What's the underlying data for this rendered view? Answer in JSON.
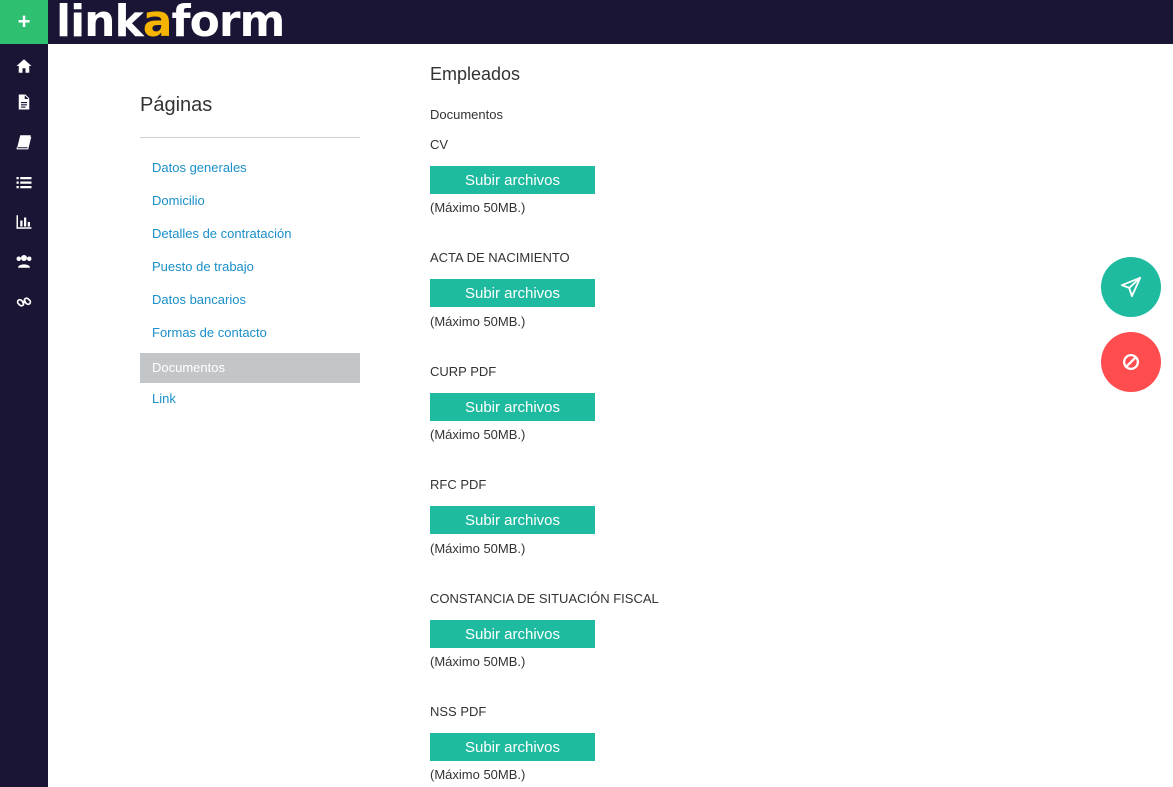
{
  "app": {
    "logo_pre": "link",
    "logo_accent": "a",
    "logo_post": "form",
    "add_label": "+"
  },
  "rail": {
    "icons": [
      "home-icon",
      "document-icon",
      "book-icon",
      "list-icon",
      "bar-chart-icon",
      "users-icon",
      "link-icon"
    ]
  },
  "pages": {
    "title": "Páginas",
    "items": [
      {
        "label": "Datos generales",
        "active": false
      },
      {
        "label": "Domicilio",
        "active": false
      },
      {
        "label": "Detalles de contratación",
        "active": false
      },
      {
        "label": "Puesto de trabajo",
        "active": false
      },
      {
        "label": "Datos bancarios",
        "active": false
      },
      {
        "label": "Formas de contacto",
        "active": false
      },
      {
        "label": "Documentos",
        "active": true
      },
      {
        "label": "Link",
        "active": false
      }
    ]
  },
  "form": {
    "title": "Empleados",
    "section": "Documentos",
    "upload_label": "Subir archivos",
    "max_note": "(Máximo 50MB.)",
    "fields": [
      {
        "label": "CV"
      },
      {
        "label": "ACTA DE NACIMIENTO"
      },
      {
        "label": "CURP PDF"
      },
      {
        "label": "RFC PDF"
      },
      {
        "label": "CONSTANCIA DE SITUACIÓN FISCAL"
      },
      {
        "label": "NSS PDF"
      }
    ]
  },
  "colors": {
    "topbar": "#1b1535",
    "add_button": "#2fbf71",
    "logo_accent": "#f4b400",
    "primary": "#1fbba0",
    "danger": "#ff4d4f",
    "link": "#1a8fc9",
    "active_page": "#c3c6c9"
  },
  "fabs": {
    "send": "send-icon",
    "cancel": "cancel-icon"
  }
}
